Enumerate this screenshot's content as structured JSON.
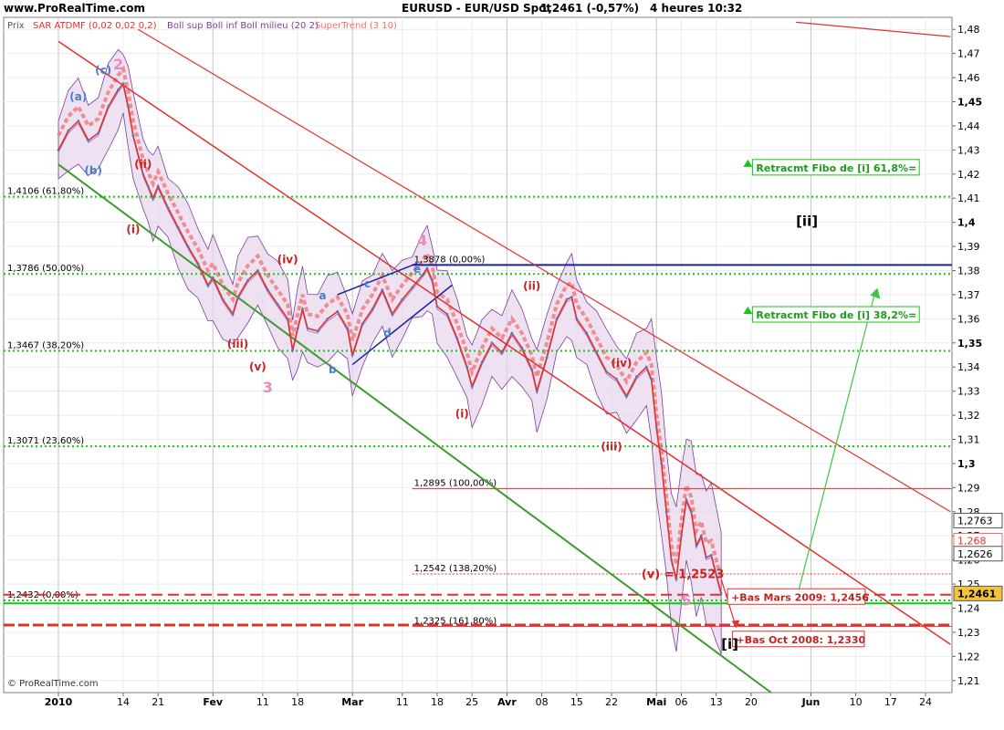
{
  "header": {
    "site": "www.ProRealTime.com",
    "title": "EURUSD - EUR/USD Spot",
    "last": "1,2461 (-0,57%)",
    "period": "4 heures  10:32"
  },
  "legend": {
    "prix": "Prix",
    "sar": "SAR ATDMF (0,02 0,02 0,2)",
    "boll": "Boll sup Boll inf Boll milieu (20 2)",
    "supertrend": "SuperTrend (3 10)"
  },
  "colors": {
    "price_line": "#e2302c",
    "channel": "#e2302c",
    "green_channel": "#3a9d2a",
    "fib_green": "#19c519",
    "blue_level": "#1a22a6",
    "boll_fill": "#e6d4ec",
    "boll_line": "#7e3d9b",
    "supertrend_red": "#f07070",
    "supertrend_green": "#31b431",
    "wave_red": "#c62222",
    "wave_pink": "#e889c1",
    "wave_blue": "#4a7dc9",
    "scenario": "#40c440"
  },
  "footer": {
    "credit": "© ProRealTime.com"
  },
  "chart_data": {
    "type": "line",
    "title": "EURUSD - EUR/USD Spot",
    "ylim": [
      1.205,
      1.485
    ],
    "y_ticks": [
      "1,21",
      "1,22",
      "1,23",
      "1,24",
      "1,25",
      "1,26",
      "1,27",
      "1,28",
      "1,29",
      "1,3",
      "1,31",
      "1,32",
      "1,33",
      "1,34",
      "1,35",
      "1,36",
      "1,37",
      "1,38",
      "1,39",
      "1,4",
      "1,41",
      "1,42",
      "1,43",
      "1,44",
      "1,45",
      "1,46",
      "1,47",
      "1,48"
    ],
    "y_ticks_bold": [
      "1,3",
      "1,35",
      "1,4",
      "1,45"
    ],
    "x_ticks": [
      {
        "label": "2010",
        "d": 0,
        "bold": true
      },
      {
        "label": "14",
        "d": 13
      },
      {
        "label": "21",
        "d": 20
      },
      {
        "label": "Fev",
        "d": 31,
        "bold": true
      },
      {
        "label": "11",
        "d": 41
      },
      {
        "label": "18",
        "d": 48
      },
      {
        "label": "Mar",
        "d": 59,
        "bold": true
      },
      {
        "label": "11",
        "d": 69
      },
      {
        "label": "18",
        "d": 76
      },
      {
        "label": "25",
        "d": 83
      },
      {
        "label": "Avr",
        "d": 90,
        "bold": true
      },
      {
        "label": "08",
        "d": 97
      },
      {
        "label": "15",
        "d": 104
      },
      {
        "label": "22",
        "d": 111
      },
      {
        "label": "Mai",
        "d": 120,
        "bold": true
      },
      {
        "label": "06",
        "d": 125
      },
      {
        "label": "13",
        "d": 132
      },
      {
        "label": "20",
        "d": 139
      },
      {
        "label": "Jun",
        "d": 151,
        "bold": true
      },
      {
        "label": "10",
        "d": 160
      },
      {
        "label": "17",
        "d": 167
      },
      {
        "label": "24",
        "d": 174
      }
    ],
    "xlim_days": [
      0,
      179
    ],
    "series": [
      {
        "name": "EURUSD",
        "points": [
          [
            0,
            1.43
          ],
          [
            2,
            1.438
          ],
          [
            4,
            1.442
          ],
          [
            6,
            1.434
          ],
          [
            8,
            1.437
          ],
          [
            10,
            1.448
          ],
          [
            12,
            1.455
          ],
          [
            13,
            1.4575
          ],
          [
            14,
            1.448
          ],
          [
            15,
            1.436
          ],
          [
            17,
            1.42
          ],
          [
            18,
            1.415
          ],
          [
            19,
            1.41
          ],
          [
            20,
            1.415
          ],
          [
            22,
            1.406
          ],
          [
            24,
            1.398
          ],
          [
            26,
            1.39
          ],
          [
            28,
            1.383
          ],
          [
            30,
            1.374
          ],
          [
            31,
            1.377
          ],
          [
            33,
            1.368
          ],
          [
            35,
            1.362
          ],
          [
            36,
            1.369
          ],
          [
            38,
            1.376
          ],
          [
            40,
            1.38
          ],
          [
            42,
            1.372
          ],
          [
            44,
            1.366
          ],
          [
            46,
            1.36
          ],
          [
            47,
            1.347
          ],
          [
            48,
            1.356
          ],
          [
            49,
            1.364
          ],
          [
            50,
            1.356
          ],
          [
            52,
            1.355
          ],
          [
            54,
            1.36
          ],
          [
            56,
            1.363
          ],
          [
            58,
            1.356
          ],
          [
            59,
            1.345
          ],
          [
            61,
            1.358
          ],
          [
            63,
            1.364
          ],
          [
            65,
            1.372
          ],
          [
            67,
            1.362
          ],
          [
            69,
            1.368
          ],
          [
            71,
            1.373
          ],
          [
            73,
            1.378
          ],
          [
            74,
            1.381
          ],
          [
            75,
            1.376
          ],
          [
            76,
            1.365
          ],
          [
            78,
            1.362
          ],
          [
            80,
            1.352
          ],
          [
            82,
            1.34
          ],
          [
            83,
            1.332
          ],
          [
            85,
            1.342
          ],
          [
            87,
            1.35
          ],
          [
            89,
            1.346
          ],
          [
            91,
            1.354
          ],
          [
            93,
            1.348
          ],
          [
            95,
            1.339
          ],
          [
            96,
            1.33
          ],
          [
            98,
            1.344
          ],
          [
            100,
            1.36
          ],
          [
            102,
            1.368
          ],
          [
            103,
            1.369
          ],
          [
            104,
            1.36
          ],
          [
            106,
            1.354
          ],
          [
            108,
            1.346
          ],
          [
            110,
            1.338
          ],
          [
            112,
            1.335
          ],
          [
            114,
            1.328
          ],
          [
            116,
            1.336
          ],
          [
            118,
            1.34
          ],
          [
            119,
            1.335
          ],
          [
            120,
            1.315
          ],
          [
            121,
            1.3
          ],
          [
            122,
            1.28
          ],
          [
            123,
            1.26
          ],
          [
            124,
            1.252
          ],
          [
            125,
            1.27
          ],
          [
            126,
            1.285
          ],
          [
            127,
            1.28
          ],
          [
            128,
            1.266
          ],
          [
            129,
            1.27
          ],
          [
            130,
            1.261
          ],
          [
            131,
            1.262
          ],
          [
            132,
            1.254
          ],
          [
            133,
            1.2461
          ]
        ]
      }
    ],
    "fibo_levels": [
      {
        "label": "1,4106 (61,80%)",
        "y": 1.4106
      },
      {
        "label": "1,3786 (50,00%)",
        "y": 1.3786
      },
      {
        "label": "1,3467 (38,20%)",
        "y": 1.3467
      },
      {
        "label": "1,3071 (23,60%)",
        "y": 1.3071
      },
      {
        "label": "1,2432 (0,00%)",
        "y": 1.2432
      }
    ],
    "projection_levels": [
      {
        "label": "1,3878 (0,00%)",
        "y": 1.3823
      },
      {
        "label": "1,2895 (100,00%)",
        "y": 1.2895
      },
      {
        "label": "1,2542 (138,20%)",
        "y": 1.2542
      },
      {
        "label": "1,2325 (161,80%)",
        "y": 1.2325
      }
    ],
    "price_tags": [
      {
        "label": "1,2763",
        "y": 1.2763,
        "style": "plain"
      },
      {
        "label": "1,268",
        "y": 1.268,
        "style": "pink"
      },
      {
        "label": "1,2626",
        "y": 1.2626,
        "style": "plain"
      },
      {
        "label": "1,2461",
        "y": 1.2461,
        "style": "last"
      }
    ],
    "annotations": [
      {
        "text": "Retracmt Fibo de [i] 61,8%=",
        "d": 140,
        "y": 1.4215,
        "kind": "box-green"
      },
      {
        "text": "Retracmt Fibo de [i] 38,2%=",
        "d": 140,
        "y": 1.3605,
        "kind": "box-green"
      },
      {
        "text": "+Bas Mars 2009: 1,2456",
        "d": 135,
        "y": 1.2435,
        "kind": "box-red"
      },
      {
        "text": "+Bas Oct 2008: 1,2330",
        "d": 136,
        "y": 1.2259,
        "kind": "box-red"
      },
      {
        "text": "(v) = 1,2523",
        "d": 117,
        "y": 1.2525,
        "kind": "red-text"
      },
      {
        "text": "[ii]",
        "d": 148,
        "y": 1.3985,
        "kind": "black"
      },
      {
        "text": "[i]",
        "d": 133,
        "y": 1.2232,
        "kind": "black"
      }
    ],
    "wave_labels": [
      {
        "t": "(c)",
        "d": 9,
        "y": 1.4615,
        "c": "blue"
      },
      {
        "t": "2",
        "d": 12,
        "y": 1.4635,
        "c": "pink"
      },
      {
        "t": "(a)",
        "d": 4,
        "y": 1.4505,
        "c": "blue"
      },
      {
        "t": "(b)",
        "d": 7,
        "y": 1.42,
        "c": "blue"
      },
      {
        "t": "(ii)",
        "d": 17,
        "y": 1.4225,
        "c": "red"
      },
      {
        "t": "(i)",
        "d": 15,
        "y": 1.3955,
        "c": "red"
      },
      {
        "t": "(iv)",
        "d": 46,
        "y": 1.383,
        "c": "red"
      },
      {
        "t": "(iii)",
        "d": 36,
        "y": 1.348,
        "c": "red"
      },
      {
        "t": "(v)",
        "d": 40,
        "y": 1.3385,
        "c": "red"
      },
      {
        "t": "3",
        "d": 42,
        "y": 1.3295,
        "c": "pink"
      },
      {
        "t": "4",
        "d": 73,
        "y": 1.3905,
        "c": "pink"
      },
      {
        "t": "a",
        "d": 53,
        "y": 1.368,
        "c": "blue"
      },
      {
        "t": "b",
        "d": 55,
        "y": 1.3375,
        "c": "blue"
      },
      {
        "t": "c",
        "d": 62,
        "y": 1.373,
        "c": "blue"
      },
      {
        "t": "d",
        "d": 66,
        "y": 1.3525,
        "c": "blue"
      },
      {
        "t": "e",
        "d": 72,
        "y": 1.379,
        "c": "blue"
      },
      {
        "t": "(i)",
        "d": 81,
        "y": 1.319,
        "c": "red"
      },
      {
        "t": "(ii)",
        "d": 95,
        "y": 1.372,
        "c": "red"
      },
      {
        "t": "(iv)",
        "d": 113,
        "y": 1.34,
        "c": "red"
      },
      {
        "t": "(iii)",
        "d": 111,
        "y": 1.3055,
        "c": "red"
      },
      {
        "t": "5",
        "d": 126,
        "y": 1.2412,
        "c": "pink"
      }
    ]
  }
}
